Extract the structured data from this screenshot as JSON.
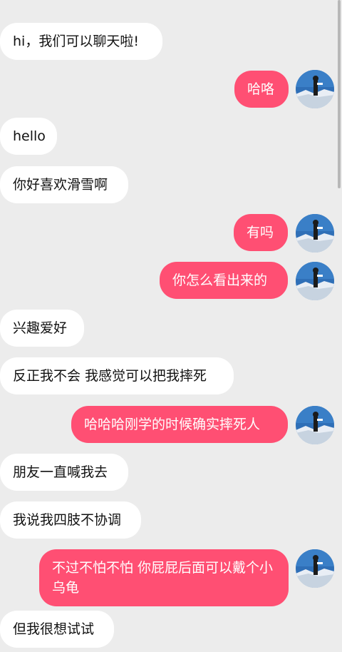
{
  "messages": [
    {
      "side": "left",
      "text": "hi，我们可以聊天啦!"
    },
    {
      "side": "right",
      "text": "哈咯"
    },
    {
      "side": "left",
      "text": "hello"
    },
    {
      "side": "left",
      "text": "你好喜欢滑雪啊"
    },
    {
      "side": "right",
      "text": "有吗"
    },
    {
      "side": "right",
      "text": "你怎么看出来的"
    },
    {
      "side": "left",
      "text": "兴趣爱好"
    },
    {
      "side": "left",
      "text": "反正我不会 我感觉可以把我摔死"
    },
    {
      "side": "right",
      "text": "哈哈哈刚学的时候确实摔死人"
    },
    {
      "side": "left",
      "text": "朋友一直喊我去"
    },
    {
      "side": "left",
      "text": "我说我四肢不协调"
    },
    {
      "side": "right",
      "text": "不过不怕不怕 你屁屁后面可以戴个小乌龟"
    },
    {
      "side": "left",
      "text": "但我很想试试"
    }
  ],
  "colors": {
    "background": "#ececec",
    "incoming_bubble": "#ffffff",
    "outgoing_bubble": "#ff4f73"
  },
  "icons": {
    "avatar": "skier-avatar-icon"
  }
}
